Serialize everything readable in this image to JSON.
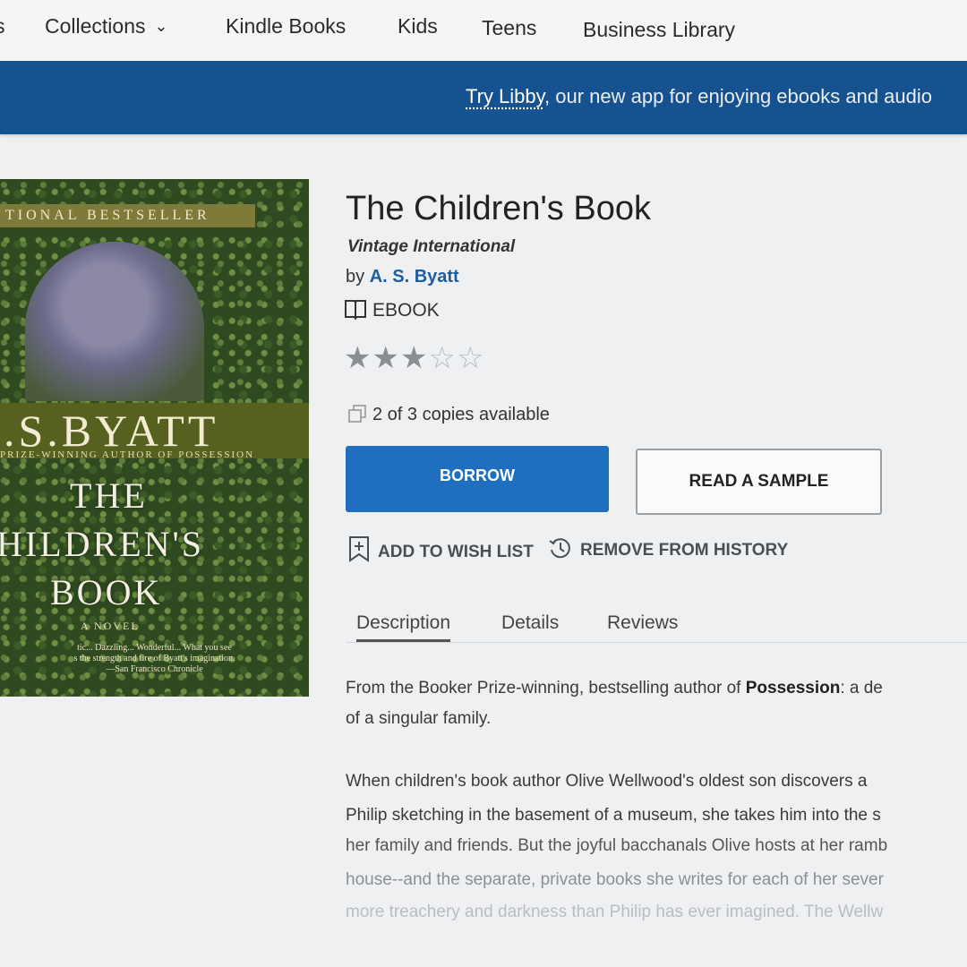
{
  "nav": {
    "partial_left": "s",
    "items": [
      "Collections",
      "Kindle Books",
      "Kids",
      "Teens",
      "Business Library"
    ]
  },
  "banner": {
    "link": "Try Libby",
    "text": ", our new app for enjoying ebooks and audio"
  },
  "cover": {
    "band": "TIONAL BESTSELLER",
    "author": ".S.BYATT",
    "prize": "PRIZE-WINNING AUTHOR OF POSSESSION",
    "title_lines": [
      "THE",
      "HILDREN'S",
      "BOOK"
    ],
    "subtitle": "A NOVEL",
    "quote_lines": [
      "tic... Dazzling... Wonderful... What you see",
      "s the strength and fire of Byatt's imagination.",
      "—San Francisco Chronicle"
    ]
  },
  "book": {
    "title": "The Children's Book",
    "publisher": "Vintage International",
    "by": "by ",
    "author": "A. S. Byatt",
    "format": "EBOOK",
    "rating": 3,
    "rating_max": 5,
    "copies": "2 of 3 copies available"
  },
  "buttons": {
    "borrow": "BORROW",
    "sample": "READ A SAMPLE",
    "wish": "ADD TO WISH LIST",
    "history": "REMOVE FROM HISTORY"
  },
  "tabs": [
    "Description",
    "Details",
    "Reviews"
  ],
  "description": {
    "p1_a": "From the Booker Prize-winning, bestselling author of ",
    "p1_b": "Possession",
    "p1_c": ": a de",
    "p1_line2": "of a singular family.",
    "p2_lines": [
      "When children's book author Olive Wellwood's oldest son discovers a",
      "Philip sketching in the basement of a museum, she takes him into the s",
      "her family and friends. But the joyful bacchanals Olive hosts at her ramb",
      "house--and the separate, private books she writes for each of her sever",
      "more treachery and darkness than Philip has ever imagined. The Wellw"
    ]
  },
  "colors": {
    "banner": "#16528f",
    "borrow": "#1f6fc0",
    "link": "#1d5ea3"
  }
}
